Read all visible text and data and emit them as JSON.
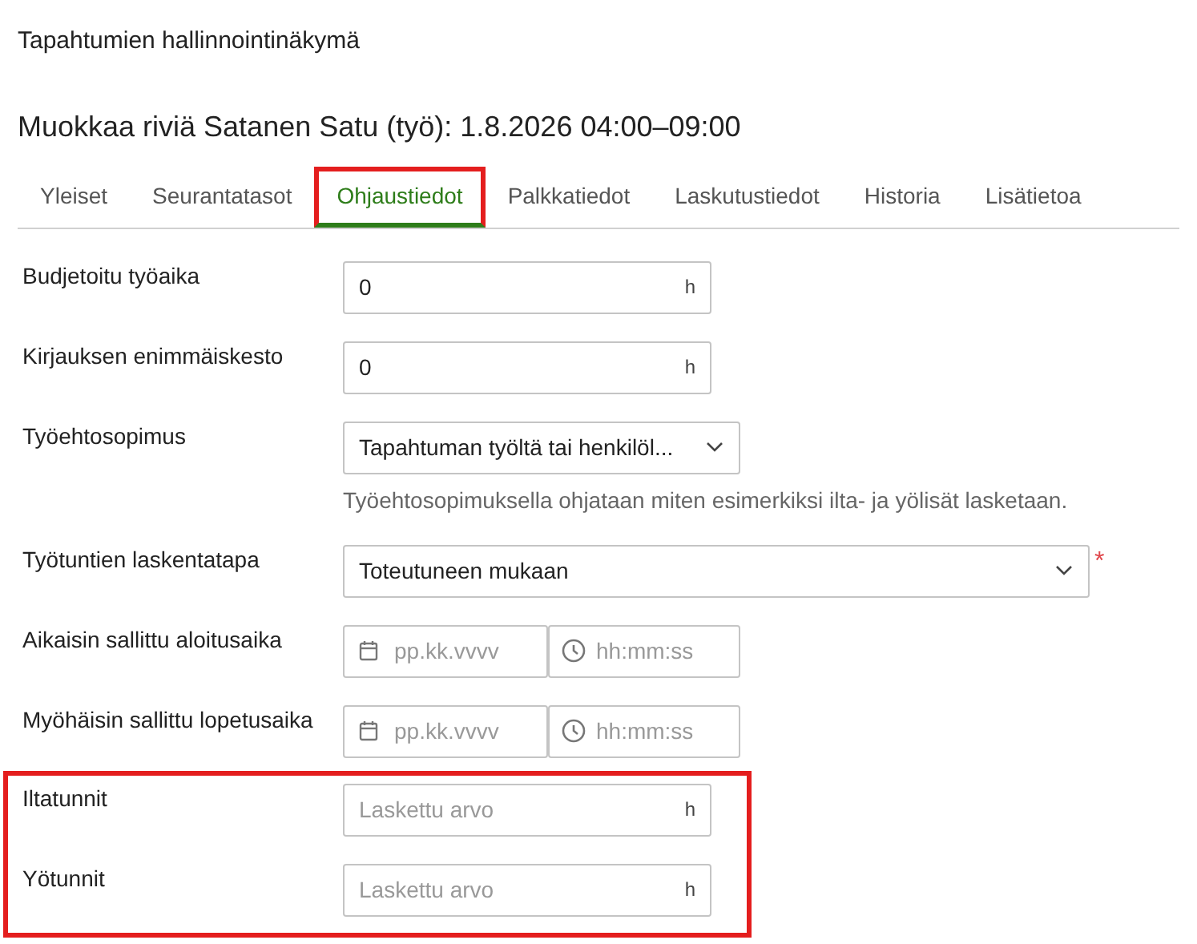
{
  "page_title": "Tapahtumien hallinnointinäkymä",
  "heading": "Muokkaa riviä Satanen Satu (työ): 1.8.2026 04:00–09:00",
  "tabs": [
    {
      "label": "Yleiset",
      "selected": false,
      "highlighted": false
    },
    {
      "label": "Seurantatasot",
      "selected": false,
      "highlighted": false
    },
    {
      "label": "Ohjaustiedot",
      "selected": true,
      "highlighted": true
    },
    {
      "label": "Palkkatiedot",
      "selected": false,
      "highlighted": false
    },
    {
      "label": "Laskutustiedot",
      "selected": false,
      "highlighted": false
    },
    {
      "label": "Historia",
      "selected": false,
      "highlighted": false
    },
    {
      "label": "Lisätietoa",
      "selected": false,
      "highlighted": false
    }
  ],
  "groups": [
    {
      "highlighted": false,
      "rows": [
        {
          "kind": "number",
          "label": "Budjetoitu työaika",
          "value": "0",
          "unit": "h"
        },
        {
          "kind": "number",
          "label": "Kirjauksen enimmäiskesto",
          "value": "0",
          "unit": "h"
        },
        {
          "kind": "select",
          "label": "Työehtosopimus",
          "value": "Tapahtuman työltä tai henkilöl...",
          "hint": "Työehtosopimuksella ohjataan miten esimerkiksi ilta- ja yölisät lasketaan.",
          "wide": false
        },
        {
          "kind": "select",
          "label": "Työtuntien laskentatapa",
          "value": "Toteutuneen mukaan",
          "wide": true,
          "required_mark": "*"
        },
        {
          "kind": "datetime",
          "label": "Aikaisin sallittu aloitusaika",
          "date_placeholder": "pp.kk.vvvv",
          "time_placeholder": "hh:mm:ss"
        },
        {
          "kind": "datetime",
          "label": "Myöhäisin sallittu lopetusaika",
          "date_placeholder": "pp.kk.vvvv",
          "time_placeholder": "hh:mm:ss"
        }
      ]
    },
    {
      "highlighted": true,
      "rows": [
        {
          "kind": "computed",
          "label": "Iltatunnit",
          "placeholder": "Laskettu arvo",
          "unit": "h"
        },
        {
          "kind": "computed",
          "label": "Yötunnit",
          "placeholder": "Laskettu arvo",
          "unit": "h"
        }
      ]
    }
  ]
}
